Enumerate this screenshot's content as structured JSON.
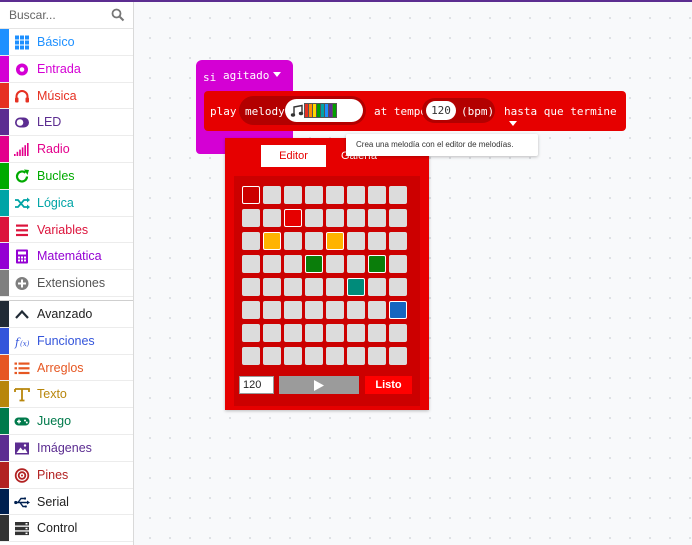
{
  "search": {
    "placeholder": "Buscar..."
  },
  "toolbox": {
    "categories": [
      {
        "label": "Básico",
        "color": "#1e90ff",
        "icon": "grid-icon"
      },
      {
        "label": "Entrada",
        "color": "#d400d4",
        "icon": "circle-dot-icon"
      },
      {
        "label": "Música",
        "color": "#e63022",
        "icon": "headphones-icon"
      },
      {
        "label": "LED",
        "color": "#5c2d91",
        "icon": "toggle-icon"
      },
      {
        "label": "Radio",
        "color": "#e3008c",
        "icon": "signal-bars-icon"
      },
      {
        "label": "Bucles",
        "color": "#00aa00",
        "icon": "refresh-icon"
      },
      {
        "label": "Lógica",
        "color": "#00a4a6",
        "icon": "shuffle-icon"
      },
      {
        "label": "Variables",
        "color": "#dc143c",
        "icon": "list-lines-icon"
      },
      {
        "label": "Matemática",
        "color": "#9400d3",
        "icon": "calculator-icon"
      },
      {
        "label": "Extensiones",
        "color": "#7f7f7f",
        "icon": "plus-circle-icon"
      }
    ],
    "advanced": [
      {
        "label": "Avanzado",
        "color": "#212b36",
        "icon": "chevron-up-icon"
      },
      {
        "label": "Funciones",
        "color": "#3455db",
        "icon": "function-icon"
      },
      {
        "label": "Arreglos",
        "color": "#e65722",
        "icon": "list-numbered-icon"
      },
      {
        "label": "Texto",
        "color": "#b8860b",
        "icon": "text-icon"
      },
      {
        "label": "Juego",
        "color": "#007a4b",
        "icon": "gamepad-icon"
      },
      {
        "label": "Imágenes",
        "color": "#5c2d91",
        "icon": "image-icon"
      },
      {
        "label": "Pines",
        "color": "#b22222",
        "icon": "target-icon"
      },
      {
        "label": "Serial",
        "color": "#002050",
        "icon": "usb-icon"
      },
      {
        "label": "Control",
        "color": "#333333",
        "icon": "server-icon"
      }
    ]
  },
  "blocks": {
    "hat": {
      "keyword": "si",
      "event": "agitado"
    },
    "play": {
      "play_label": "play",
      "melody_label": "melody",
      "tempo_label": "at tempo",
      "tempo_value": "120",
      "tempo_unit": "(bpm)",
      "mode": "hasta que termine",
      "preview_colors": [
        "#e63022",
        "#ff8c00",
        "#ffd700",
        "#00a000",
        "#00a4a6",
        "#1e90ff",
        "#5c2d91",
        "#00a000"
      ]
    }
  },
  "melody_editor": {
    "tabs": [
      "Editor",
      "Galería"
    ],
    "rows": 8,
    "cols": 8,
    "notes": [
      {
        "row": 0,
        "col": 0,
        "color": "#cc0000"
      },
      {
        "row": 1,
        "col": 2,
        "color": "#e60000"
      },
      {
        "row": 2,
        "col": 1,
        "color": "#ffb300"
      },
      {
        "row": 2,
        "col": 4,
        "color": "#ffb300"
      },
      {
        "row": 3,
        "col": 3,
        "color": "#0a7d0a"
      },
      {
        "row": 3,
        "col": 6,
        "color": "#0a7d0a"
      },
      {
        "row": 4,
        "col": 5,
        "color": "#008b7a"
      },
      {
        "row": 5,
        "col": 7,
        "color": "#1565c0"
      }
    ],
    "bpm_value": "120",
    "done_label": "Listo"
  },
  "tooltip": {
    "text": "Crea una melodía con el editor de melodías."
  },
  "colors": {
    "music": "#e60000",
    "music_dark": "#b30000",
    "input": "#d400d4",
    "accent": "#5c2d91"
  }
}
